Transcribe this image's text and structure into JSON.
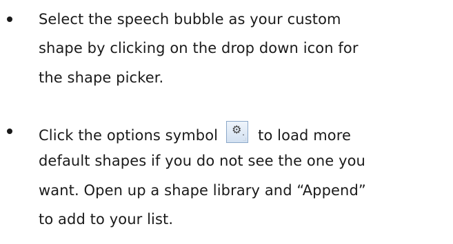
{
  "bullets": [
    {
      "lines": [
        "Select the speech bubble as your custom",
        "shape by clicking on the drop down icon for",
        "the shape picker."
      ]
    },
    {
      "line1_before_icon": "Click the options symbol",
      "line1_after_icon": "to load more",
      "icon": "options-gear-icon",
      "lines_rest": [
        "default shapes if you do not see the one you",
        "want. Open up a shape library and “Append”",
        "to add to your list."
      ]
    }
  ]
}
